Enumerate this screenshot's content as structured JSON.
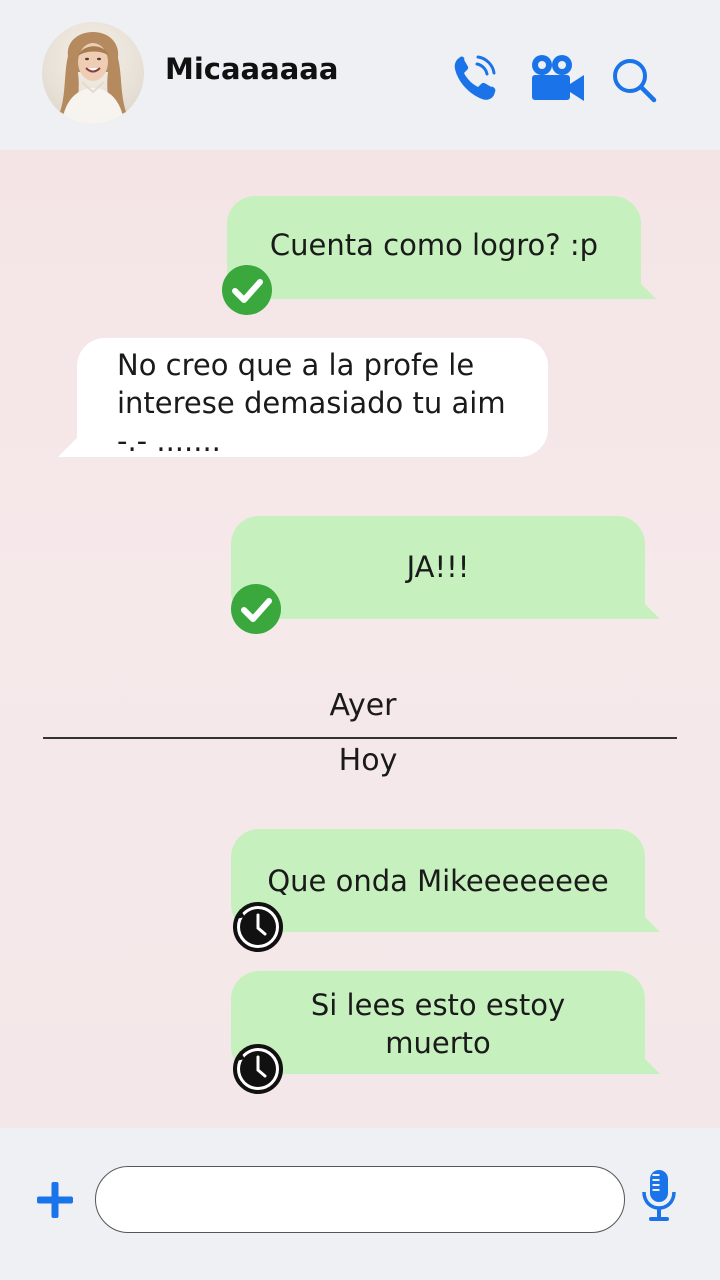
{
  "header": {
    "contact_name": "Micaaaaaa",
    "icons": [
      "phone-call-icon",
      "video-camera-icon",
      "search-icon"
    ]
  },
  "messages": [
    {
      "direction": "out",
      "lines": [
        "Cuenta como logro? :p"
      ],
      "status": "delivered-check-icon"
    },
    {
      "direction": "in",
      "lines": [
        "No creo que a la profe le",
        "interese demasiado tu aim",
        "-.- ......."
      ]
    },
    {
      "direction": "out",
      "lines": [
        "JA!!!"
      ],
      "status": "delivered-check-icon"
    },
    {
      "direction": "out",
      "lines": [
        "Que onda Mikeeeeeeee"
      ],
      "status": "pending-clock-icon"
    },
    {
      "direction": "out",
      "lines": [
        "Si lees esto estoy",
        "muerto"
      ],
      "status": "pending-clock-icon"
    }
  ],
  "separators": {
    "previous_day": "Ayer",
    "current_day": "Hoy"
  },
  "composer": {
    "placeholder": "",
    "value": "",
    "icons": [
      "plus-icon",
      "microphone-icon"
    ]
  },
  "colors": {
    "accent": "#1a73e8",
    "outgoing_bubble": "#c6f0bd",
    "incoming_bubble": "#ffffff",
    "delivered_check": "#3aa83d",
    "chat_background": "#f4e4e6"
  }
}
